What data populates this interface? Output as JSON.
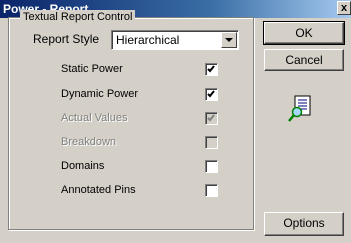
{
  "window": {
    "title": "Power - Report",
    "close_glyph": "x"
  },
  "group": {
    "legend": "Textual Report Control"
  },
  "report_style": {
    "label": "Report Style",
    "value": "Hierarchical"
  },
  "options": [
    {
      "label": "Static Power",
      "checked": true,
      "enabled": true
    },
    {
      "label": "Dynamic Power",
      "checked": true,
      "enabled": true
    },
    {
      "label": "Actual Values",
      "checked": true,
      "enabled": false
    },
    {
      "label": "Breakdown",
      "checked": false,
      "enabled": false
    },
    {
      "label": "Domains",
      "checked": false,
      "enabled": true
    },
    {
      "label": "Annotated Pins",
      "checked": false,
      "enabled": true
    }
  ],
  "buttons": {
    "ok": "OK",
    "cancel": "Cancel",
    "options": "Options"
  },
  "icons": {
    "report": "report-magnifier-icon"
  }
}
